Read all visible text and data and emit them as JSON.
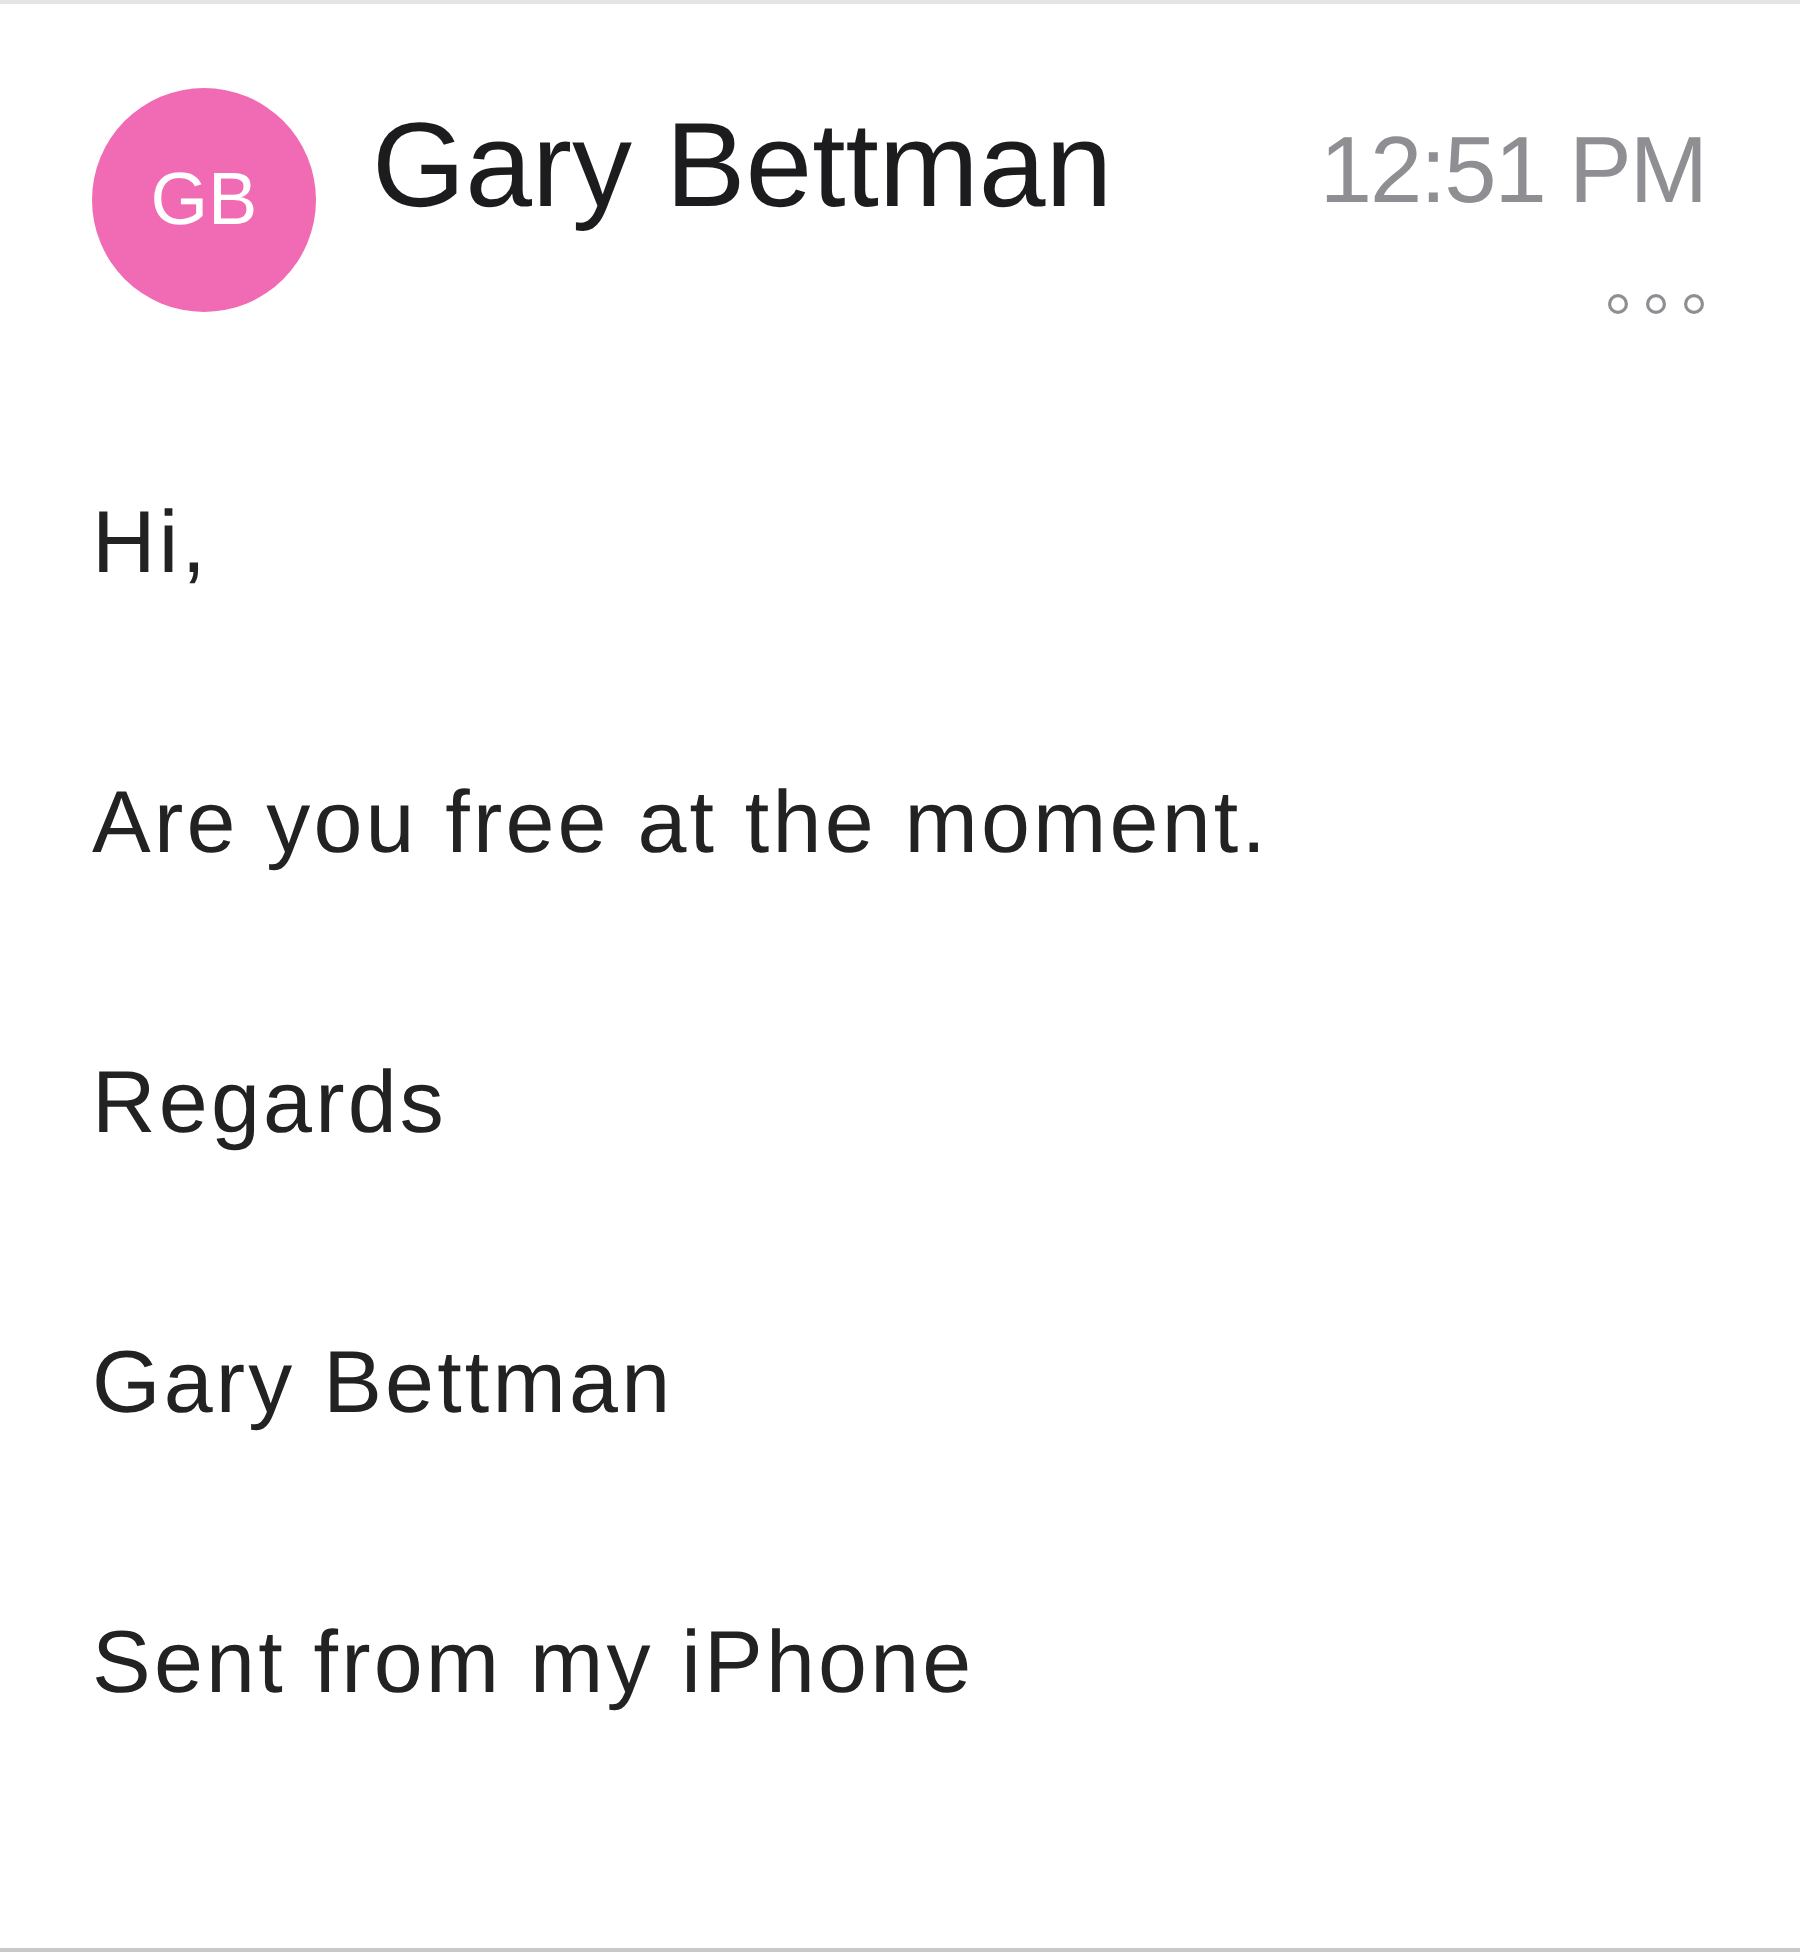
{
  "message": {
    "sender": {
      "initials": "GB",
      "name": "Gary Bettman"
    },
    "time": "12:51 PM",
    "body": [
      "Hi,",
      "Are you free at the moment.",
      "Regards",
      "Gary Bettman",
      "Sent from my iPhone"
    ]
  }
}
